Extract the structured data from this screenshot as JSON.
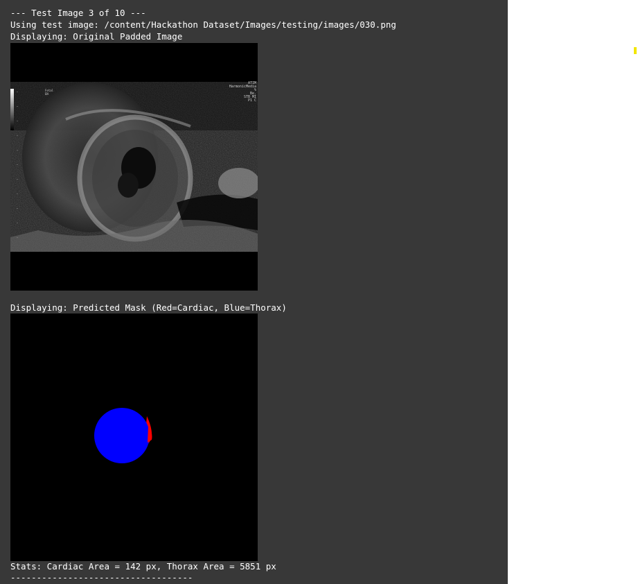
{
  "output": {
    "header_line": "--- Test Image 3 of 10 ---",
    "path_line": "Using test image: /content/Hackathon Dataset/Images/testing/images/030.png",
    "original_caption": "Displaying: Original Padded Image",
    "mask_caption": "Displaying: Predicted Mask (Red=Cardiac, Blue=Thorax)",
    "stats_line": "Stats: Cardiac Area = 142 px, Thorax Area = 5851 px",
    "separator_line": "-----------------------------------"
  },
  "ultrasound": {
    "overlay_right": "ATIM\nHarmonicMedia\n%\nBe.\nSTB MI\nP1 C",
    "overlay_left": "Fetal\nEN"
  },
  "mask": {
    "cardiac_color": "#ff0000",
    "thorax_color": "#0000ff",
    "background_color": "#000000"
  },
  "colors": {
    "panel_background": "#383838",
    "text": "#ffffff",
    "scroll_marker": "#f2e600"
  }
}
